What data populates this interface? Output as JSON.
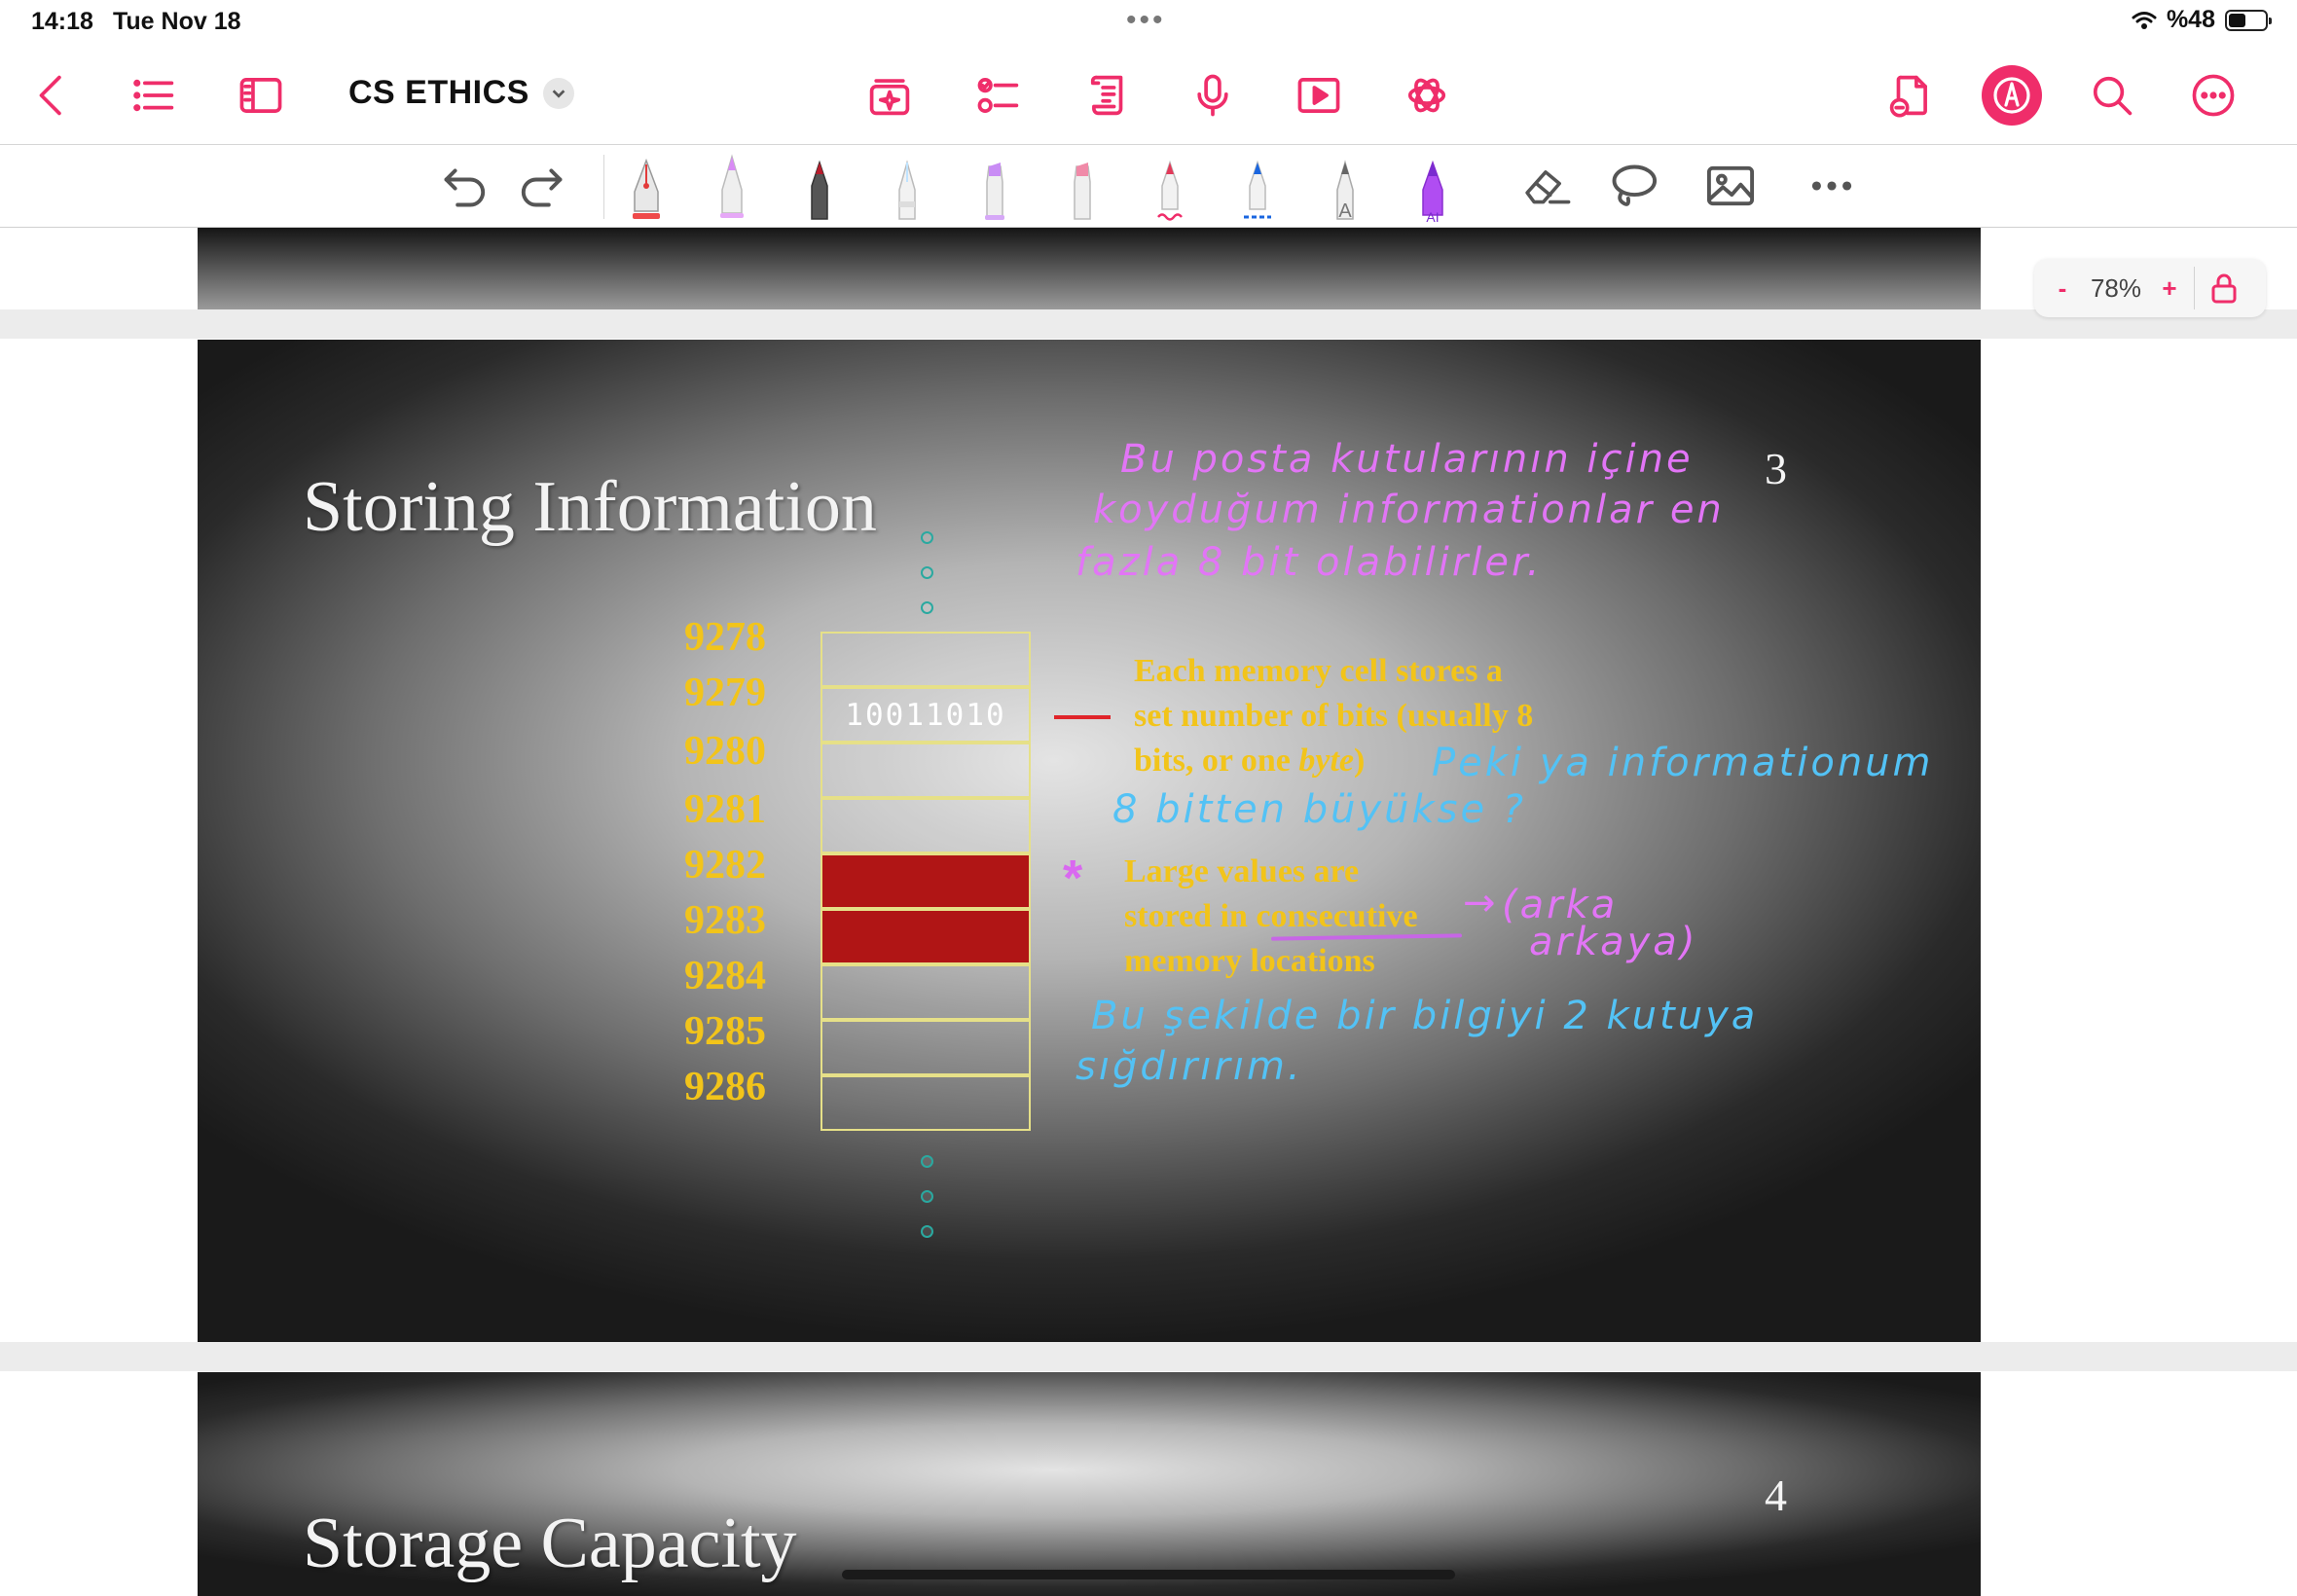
{
  "status_bar": {
    "time": "14:18",
    "date": "Tue Nov 18",
    "battery": "%48",
    "battery_level": 0.48,
    "icons": [
      "wifi-icon",
      "battery-icon"
    ]
  },
  "nav": {
    "title": "CS ETHICS",
    "accent_color": "#ef2d6a",
    "buttons": [
      "back-icon",
      "list-icon",
      "sidebar-icon",
      "chevron-down-icon",
      "ai-sparkle-icon",
      "checklist-icon",
      "scroll-icon",
      "microphone-icon",
      "play-icon",
      "openai-icon",
      "add-page-icon",
      "pencil-circle-icon",
      "search-icon",
      "more-icon"
    ]
  },
  "toolbar": {
    "tools": [
      "undo-icon",
      "redo-icon",
      "fountain-pen",
      "pink-pencil",
      "dark-red-pen",
      "light-pen",
      "purple-highlighter",
      "pink-highlighter",
      "red-wavy-pen",
      "blue-dashed-pen",
      "text-tool",
      "purple-ai-pen",
      "eraser-icon",
      "lasso-icon",
      "image-icon",
      "more-icon"
    ],
    "text_tool_label": "A",
    "ai_label": "AI"
  },
  "zoom": {
    "minus": "-",
    "value": "78%",
    "plus": "+"
  },
  "slide3": {
    "title": "Storing Information",
    "number": "3",
    "addresses": [
      "9278",
      "9279",
      "9280",
      "9281",
      "9282",
      "9283",
      "9284",
      "9285",
      "9286"
    ],
    "cells": [
      "",
      "10011010",
      "",
      "",
      "",
      "",
      "",
      "",
      ""
    ],
    "highlighted_cells": [
      4,
      5
    ],
    "bullet1_line1": "Each memory cell stores a",
    "bullet1_line2": "set number of bits (usually 8",
    "bullet1_line3_a": "bits, or one ",
    "bullet1_line3_b": "byte",
    "bullet1_line3_c": ")",
    "bullet2_line1": "Large values are",
    "bullet2_line2": "stored in consecutive",
    "bullet2_line3": "memory locations",
    "handwriting": {
      "pink1": "Bu posta kutularının içine",
      "pink2": "koyduğum   informationlar  en",
      "pink3": "fazla  8 bit olabilirler.",
      "blue1": "Peki ya  informationum",
      "blue2": "8 bitten  büyükse ?",
      "pink4": "(arka",
      "pink5": "arkaya)",
      "blue3": "Bu şekilde  bir bilgiyi 2 kutuya",
      "blue4": "sığdırırım.",
      "star": "*",
      "arrow": "→"
    }
  },
  "slide4": {
    "title": "Storage Capacity",
    "number": "4"
  }
}
